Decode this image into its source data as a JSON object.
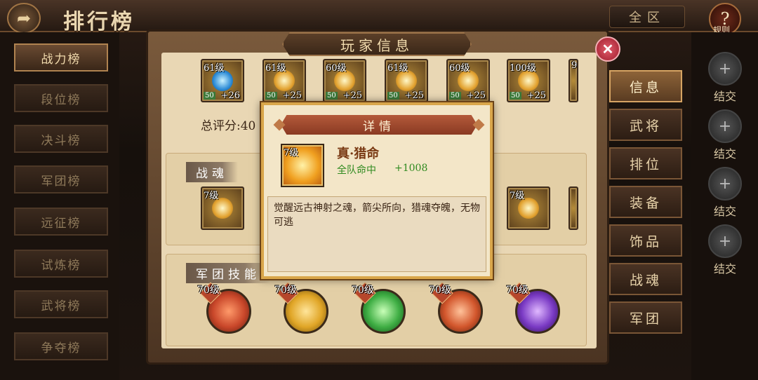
{
  "header": {
    "title": "排行榜",
    "back_icon": "back-arrow-icon",
    "region": "全区",
    "rules_label": "规则",
    "rules_icon": "question-icon"
  },
  "sidebar": {
    "items": [
      {
        "label": "战力榜",
        "active": true
      },
      {
        "label": "段位榜",
        "active": false
      },
      {
        "label": "决斗榜",
        "active": false
      },
      {
        "label": "军团榜",
        "active": false
      },
      {
        "label": "远征榜",
        "active": false
      },
      {
        "label": "试炼榜",
        "active": false
      },
      {
        "label": "武将榜",
        "active": false
      },
      {
        "label": "争夺榜",
        "active": false
      }
    ]
  },
  "friends": {
    "items": [
      {
        "label": "结交"
      },
      {
        "label": "结交"
      },
      {
        "label": "结交"
      },
      {
        "label": "结交"
      }
    ]
  },
  "panel": {
    "title": "玩家信息",
    "close_icon": "close-icon",
    "score_label": "总评分:40",
    "equipment": [
      {
        "level": "61级",
        "stars": "50",
        "plus": "+26",
        "type": "blue"
      },
      {
        "level": "61级",
        "stars": "50",
        "plus": "+25",
        "type": "gold"
      },
      {
        "level": "60级",
        "stars": "50",
        "plus": "+25",
        "type": "gold"
      },
      {
        "level": "61级",
        "stars": "50",
        "plus": "+25",
        "type": "gold"
      },
      {
        "level": "60级",
        "stars": "50",
        "plus": "+25",
        "type": "gold"
      },
      {
        "level": "100级",
        "stars": "50",
        "plus": "+25",
        "type": "gold"
      },
      {
        "level": "9",
        "stars": "",
        "plus": "",
        "type": "gold"
      }
    ],
    "soul_section_label": "战魂",
    "souls": [
      {
        "level": "7级"
      },
      {
        "level": "7级"
      },
      {
        "level": ""
      }
    ],
    "legion_section_label": "军团技能",
    "legion_skills": [
      {
        "level": "70级",
        "color": "#c9472a"
      },
      {
        "level": "70级",
        "color": "#e0a526"
      },
      {
        "level": "70级",
        "color": "#3fae44"
      },
      {
        "level": "70级",
        "color": "#d2562c"
      },
      {
        "level": "70级",
        "color": "#7a3ac4"
      }
    ]
  },
  "tabs": [
    {
      "label": "信息",
      "active": true
    },
    {
      "label": "武将",
      "active": false
    },
    {
      "label": "排位",
      "active": false
    },
    {
      "label": "装备",
      "active": false
    },
    {
      "label": "饰品",
      "active": false
    },
    {
      "label": "战魂",
      "active": false
    },
    {
      "label": "军团",
      "active": false
    }
  ],
  "dialog": {
    "title": "详情",
    "item_level": "7级",
    "item_name": "真·猎命",
    "stat_name": "全队命中",
    "stat_value": "+1008",
    "description": "觉醒远古神射之魂，箭尖所向，猎魂夺魄，无物可逃"
  },
  "colors": {
    "accent_gold": "#d9a64a",
    "stat_green": "#2f8a1f",
    "close_red": "#c9323f"
  }
}
